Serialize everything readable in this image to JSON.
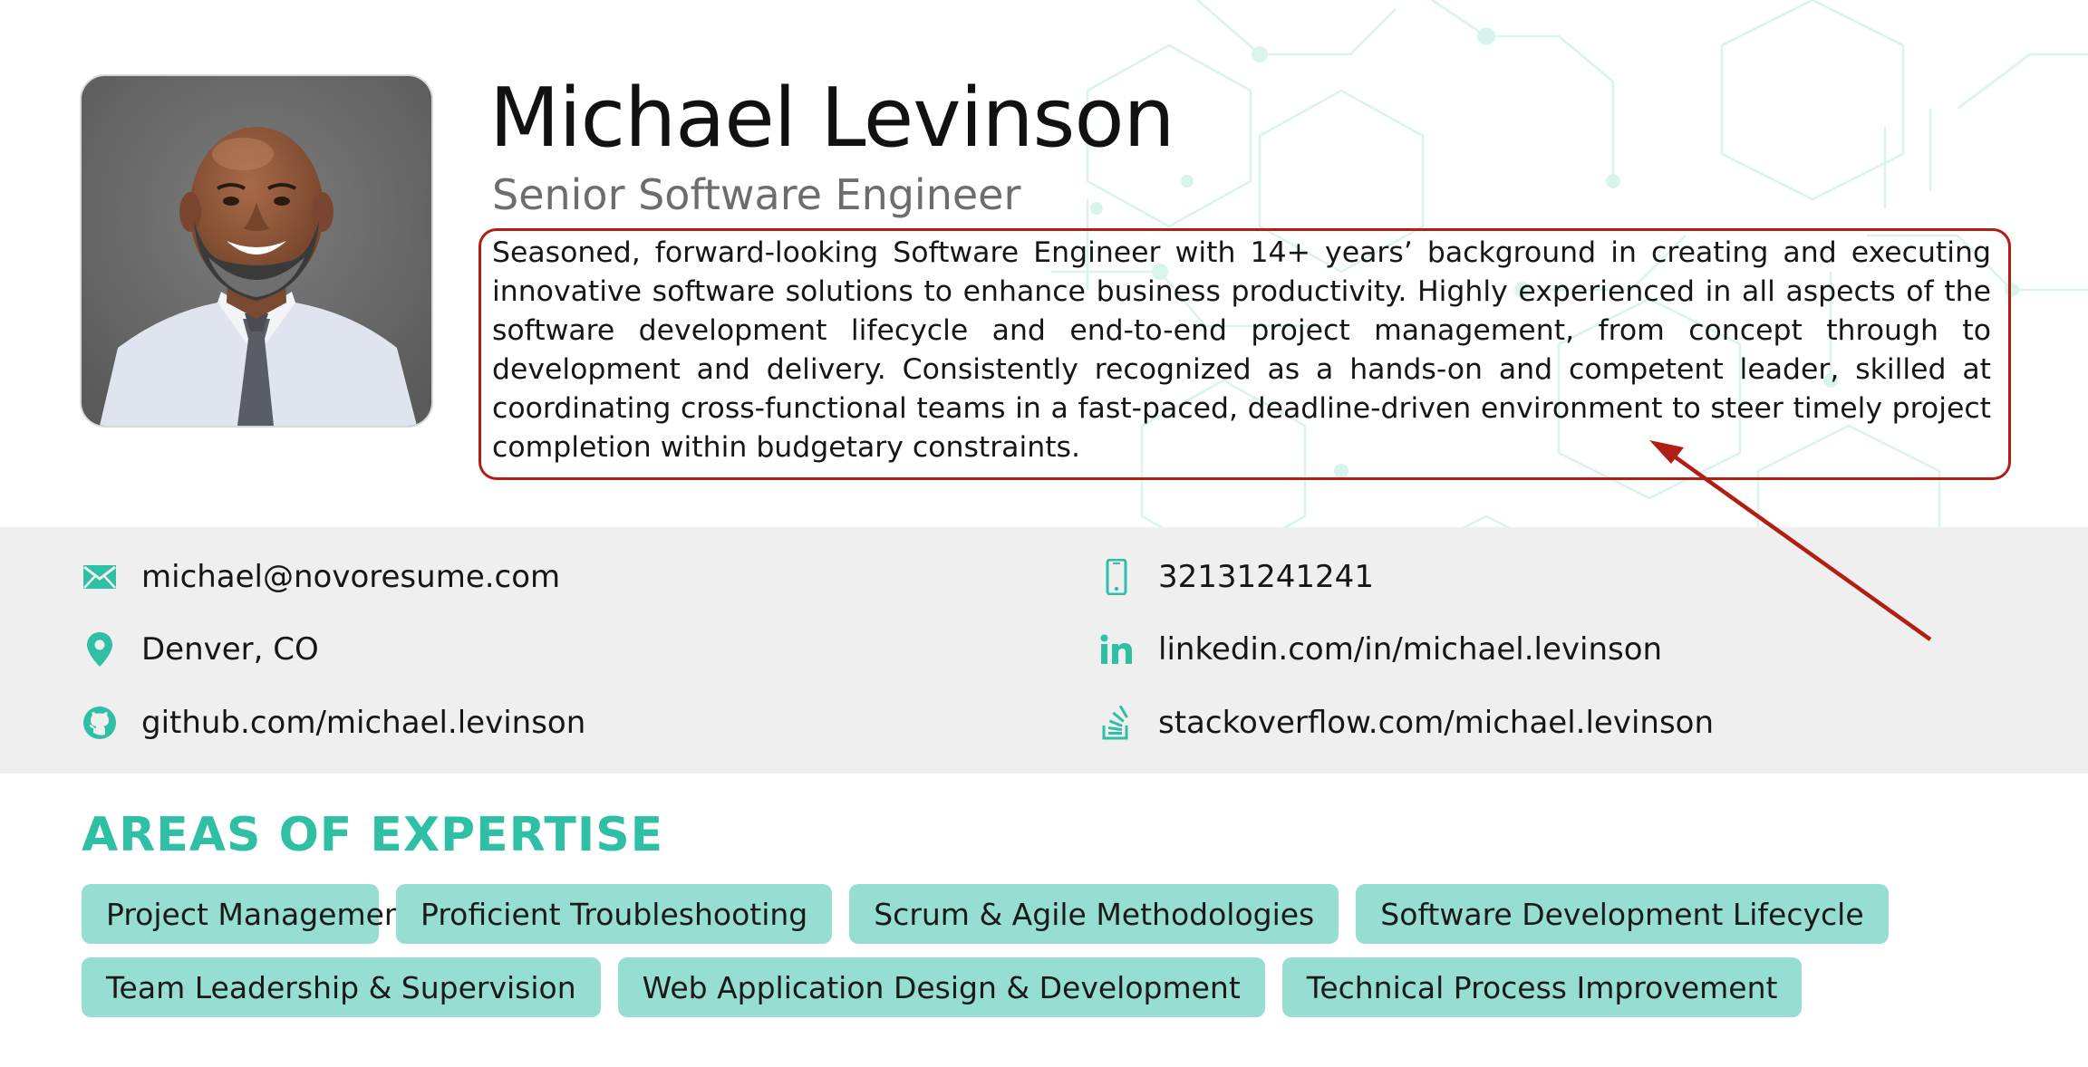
{
  "header": {
    "name": "Michael Levinson",
    "title": "Senior Software Engineer",
    "summary": "Seasoned, forward-looking Software Engineer with 14+ years’ background in creating and executing innovative software solutions to enhance business productivity. Highly experienced in all aspects of the software development lifecycle and end-to-end project management, from concept through to development and delivery. Consistently recognized as a hands-on and competent leader, skilled at coordinating cross-functional teams in a fast-paced, deadline-driven environment to steer timely project completion within budgetary constraints."
  },
  "contact": {
    "email": {
      "icon": "envelope-icon",
      "value": "michael@novoresume.com"
    },
    "phone": {
      "icon": "mobile-phone-icon",
      "value": "32131241241"
    },
    "location": {
      "icon": "map-pin-icon",
      "value": "Denver, CO"
    },
    "linkedin": {
      "icon": "linkedin-icon",
      "value": "linkedin.com/in/michael.levinson"
    },
    "github": {
      "icon": "github-icon",
      "value": "github.com/michael.levinson"
    },
    "stackoverflow": {
      "icon": "stackoverflow-icon",
      "value": "stackoverflow.com/michael.levinson"
    }
  },
  "expertise": {
    "heading": "AREAS OF EXPERTISE",
    "tags": [
      "Project Management",
      "Proficient Troubleshooting",
      "Scrum & Agile Methodologies",
      "Software Development Lifecycle",
      "Team Leadership & Supervision",
      "Web Application Design & Development",
      "Technical Process Improvement"
    ]
  },
  "colors": {
    "accent": "#2fbfa4",
    "tag_background": "#96ded1",
    "annotation": "#b01e14",
    "contact_band": "#efefef"
  }
}
